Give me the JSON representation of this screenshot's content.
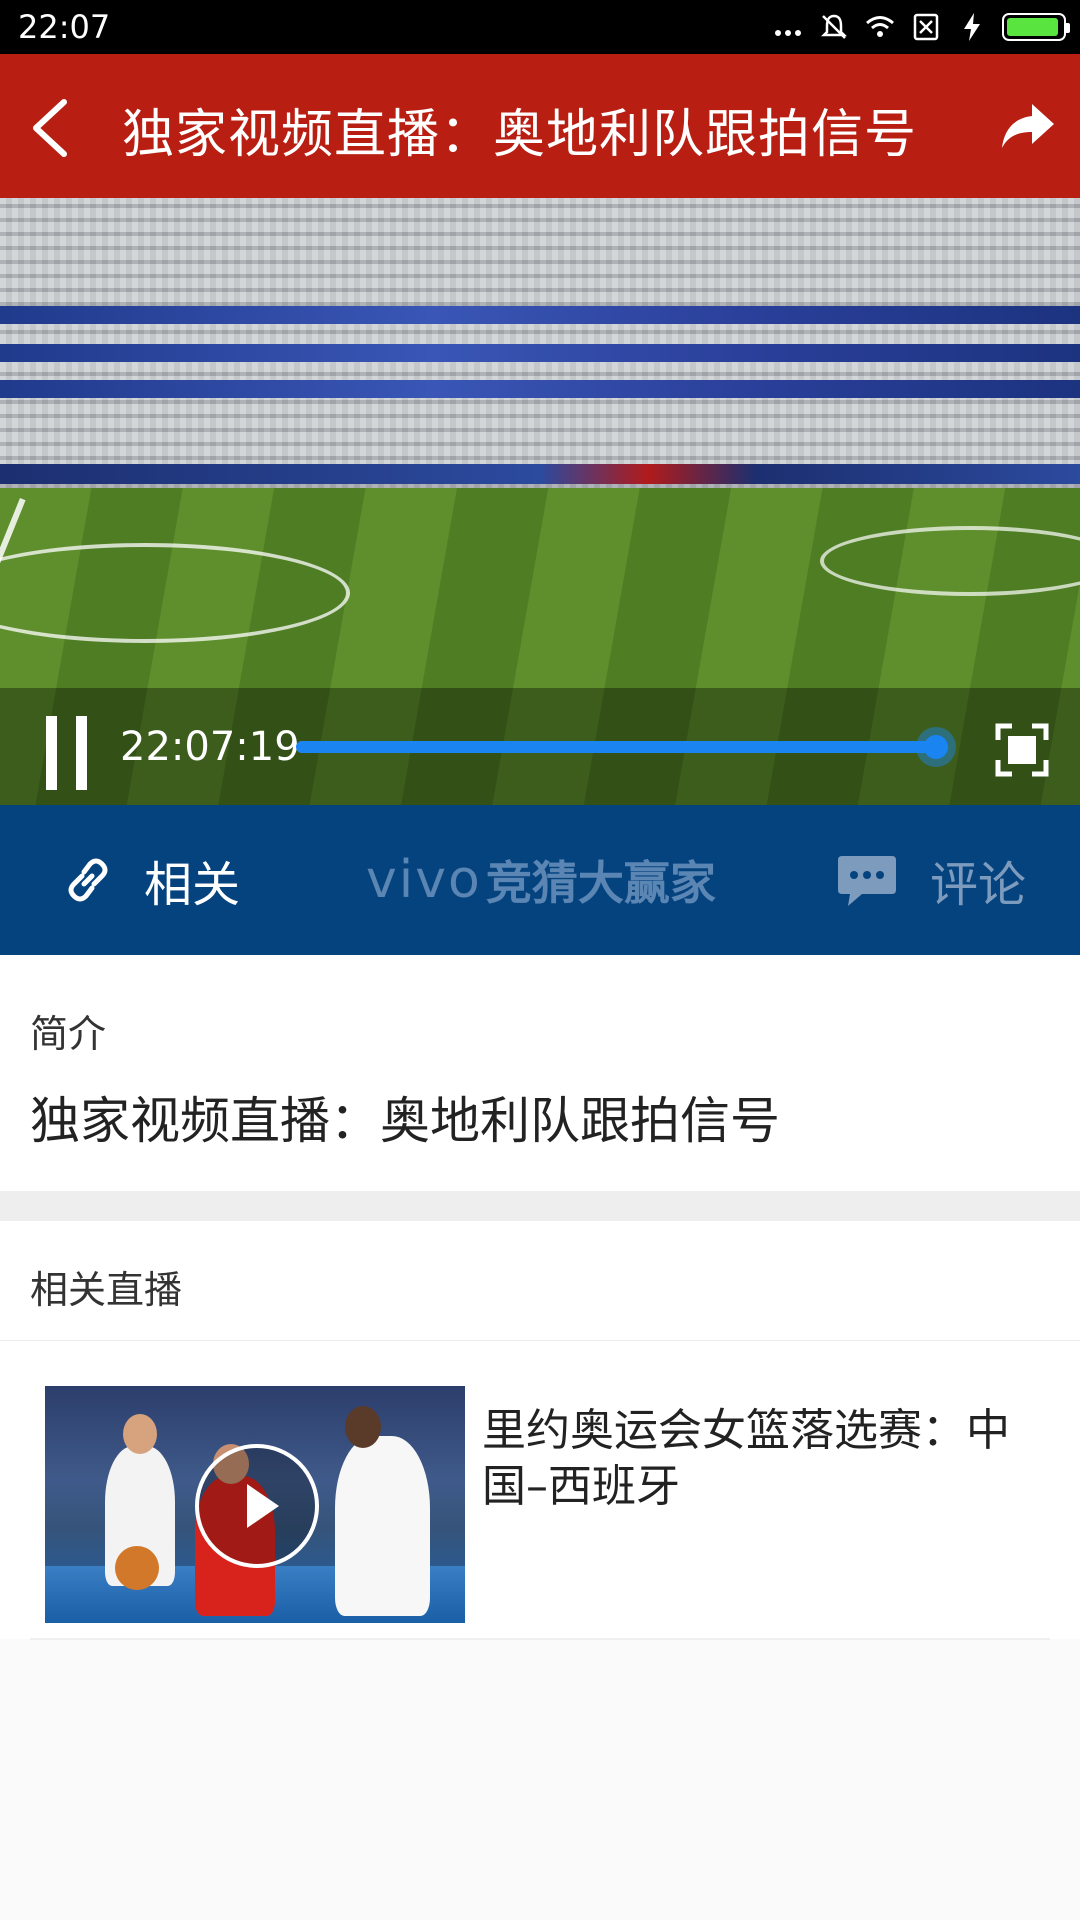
{
  "status_bar": {
    "time": "22:07",
    "battery_level": 0.95,
    "battery_color": "#5ae43f"
  },
  "header": {
    "title": "独家视频直播：奥地利队跟拍信号",
    "background_color": "#b81f12"
  },
  "video_player": {
    "current_time": "22:07:19",
    "progress": 0.99,
    "progress_color": "#1a85f0"
  },
  "tabs": [
    {
      "label": "相关",
      "icon": "link-icon"
    },
    {
      "logo": "vivo",
      "label": "竞猜大赢家"
    },
    {
      "label": "评论",
      "icon": "comment-icon"
    }
  ],
  "tab_bar_color": "#05437f",
  "intro": {
    "label": "简介",
    "description": "独家视频直播：奥地利队跟拍信号"
  },
  "related": {
    "label": "相关直播",
    "items": [
      {
        "title": "里约奥运会女篮落选赛：中国–西班牙",
        "thumbnail": "basketball-thumbnail"
      }
    ]
  }
}
